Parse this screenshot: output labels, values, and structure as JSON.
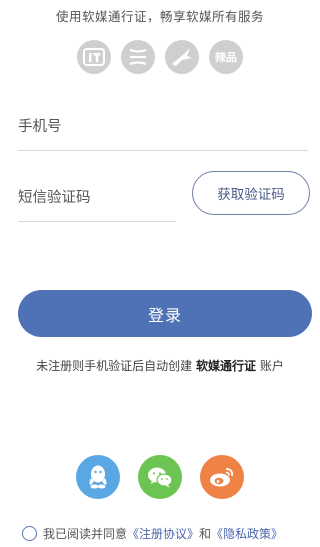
{
  "header": {
    "subtitle": "使用软媒通行证，畅享软媒所有服务"
  },
  "brands": [
    {
      "name": "ithome-icon"
    },
    {
      "name": "ruanmei-icon"
    },
    {
      "name": "bird-icon"
    },
    {
      "name": "lapin-icon",
      "label": "辣品"
    }
  ],
  "form": {
    "phone_placeholder": "手机号",
    "code_placeholder": "短信验证码",
    "get_code_label": "获取验证码",
    "login_label": "登录"
  },
  "register_note": {
    "prefix": "未注册则手机验证后自动创建 ",
    "brand": "软媒通行证",
    "suffix": " 账户"
  },
  "social": {
    "qq_color": "#5aa8e3",
    "wechat_color": "#6cc552",
    "weibo_color": "#ef8245"
  },
  "agreement": {
    "prefix": "我已阅读并同意",
    "terms": "《注册协议》",
    "and": "和",
    "privacy": "《隐私政策》"
  },
  "colors": {
    "accent": "#4f71b5"
  }
}
